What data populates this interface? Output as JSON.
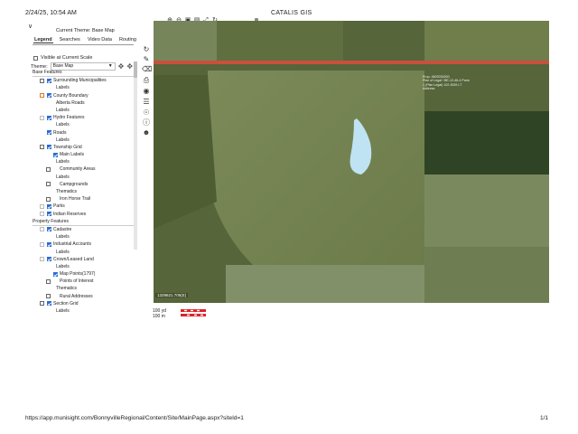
{
  "header": {
    "datetime": "2/24/25, 10:54 AM",
    "app_title": "CATALIS GIS"
  },
  "footer": {
    "url": "https://app.munisight.com/BonnyvilleRegional/Content/Site/MainPage.aspx?siteId=1",
    "page": "1/1"
  },
  "panel": {
    "current_theme_label": "Current Theme: Base Map",
    "tabs": [
      "Legend",
      "Searches",
      "Video Data",
      "Routing"
    ],
    "active_tab": "Legend",
    "visible_at_scale_label": "Visible at Current Scale",
    "theme_label": "Theme:",
    "theme_value": "Base Map"
  },
  "layers": [
    {
      "label": "Base Features",
      "type": "section"
    },
    {
      "label": "Surrounding Municipalities",
      "checked": true,
      "indent": 1,
      "box": "off"
    },
    {
      "label": "Labels",
      "indent": 3,
      "type": "sub"
    },
    {
      "label": "County Boundary",
      "checked": true,
      "indent": 1,
      "box": "orange"
    },
    {
      "label": "Alberta Roads",
      "indent": 3,
      "type": "sub",
      "box": "plain"
    },
    {
      "label": "Labels",
      "indent": 3,
      "type": "sub"
    },
    {
      "label": "Hydro Features",
      "checked": true,
      "indent": 1,
      "box": "light"
    },
    {
      "label": "Labels",
      "indent": 3,
      "type": "sub"
    },
    {
      "label": "Roads",
      "checked": true,
      "indent": 1,
      "box": "none"
    },
    {
      "label": "Labels",
      "indent": 3,
      "type": "sub"
    },
    {
      "label": "Township Grid",
      "checked": true,
      "indent": 1,
      "box": "off"
    },
    {
      "label": "Main Labels",
      "checked": true,
      "indent": 2,
      "box": "none"
    },
    {
      "label": "Labels",
      "indent": 3,
      "type": "sub"
    },
    {
      "label": "Community Areas",
      "indent": 2,
      "box": "plain"
    },
    {
      "label": "Labels",
      "indent": 3,
      "type": "sub"
    },
    {
      "label": "Campgrounds",
      "indent": 2,
      "box": "plain"
    },
    {
      "label": "Thematics",
      "indent": 3,
      "type": "sub"
    },
    {
      "label": "Iron Horse Trail",
      "indent": 2,
      "box": "plain"
    },
    {
      "label": "Parks",
      "checked": true,
      "indent": 1,
      "box": "light"
    },
    {
      "label": "Indian Reserves",
      "checked": true,
      "indent": 1,
      "box": "light"
    },
    {
      "label": "Property Features",
      "type": "section"
    },
    {
      "label": "Cadastre",
      "checked": true,
      "indent": 1,
      "box": "light"
    },
    {
      "label": "Labels",
      "indent": 3,
      "type": "sub"
    },
    {
      "label": "Industrial Accounts",
      "checked": true,
      "indent": 1,
      "box": "light"
    },
    {
      "label": "Labels",
      "indent": 3,
      "type": "sub"
    },
    {
      "label": "Crown/Leased Land",
      "checked": true,
      "indent": 1,
      "box": "light"
    },
    {
      "label": "Labels",
      "indent": 3,
      "type": "sub"
    },
    {
      "label": "Map Points(1797)",
      "checked": true,
      "indent": 2,
      "box": "none"
    },
    {
      "label": "Points of Interest",
      "indent": 2,
      "box": "plain"
    },
    {
      "label": "Thematics",
      "indent": 3,
      "type": "sub"
    },
    {
      "label": "Rural Addresses",
      "indent": 2,
      "box": "plain"
    },
    {
      "label": "Section Grid",
      "indent": 1,
      "box": "plain",
      "checked_box2": true
    },
    {
      "label": "Labels",
      "indent": 3,
      "type": "sub"
    }
  ],
  "map": {
    "coord_readout": "1329621.705(E)",
    "popup_lines": [
      "Prop. 4603030000",
      "Plan of Legal / BE-12-46-4 Parm",
      "1 (Plan Legal) 102 4539 LT",
      "Address:"
    ],
    "scale_lines": [
      "100 yd",
      "100 m"
    ]
  },
  "colors": {
    "road": "#c9503c",
    "parcel_highlight": "#6fe23a",
    "lake": "#bfe3f2",
    "checkbox_on": "#2a6ed1",
    "county_boundary_box": "#d97a2b",
    "scale_red": "#d9252a"
  },
  "icons": {
    "zoom_in": "zoom-in-icon",
    "zoom_out": "zoom-out-icon",
    "zoom_box": "zoom-box-icon",
    "full_extent": "full-extent-icon",
    "refresh": "refresh-icon",
    "pencil": "pencil-icon",
    "eraser": "eraser-icon",
    "print": "print-icon",
    "locate": "locate-icon",
    "layers": "layers-icon",
    "identify": "identify-icon",
    "user": "user-icon",
    "pan_cross": "move-icon"
  }
}
